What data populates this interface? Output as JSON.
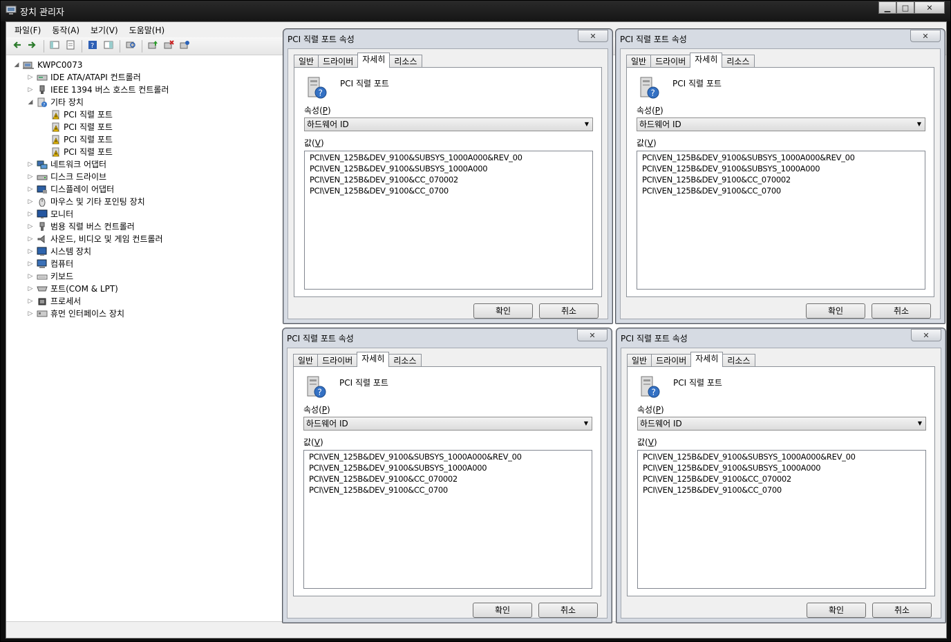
{
  "window": {
    "title": "장치 관리자",
    "min_label": "▁",
    "max_label": "□",
    "close_label": "✕"
  },
  "menu": [
    {
      "label": "파일(F)"
    },
    {
      "label": "동작(A)"
    },
    {
      "label": "보기(V)"
    },
    {
      "label": "도움말(H)"
    }
  ],
  "toolbar": {
    "icons": [
      "back-arrow-icon",
      "forward-arrow-icon",
      "show-hide-tree-icon",
      "properties-icon",
      "help-icon",
      "show-hide-action-pane-icon",
      "scan-hardware-icon",
      "update-driver-icon",
      "disable-device-icon",
      "uninstall-device-icon"
    ]
  },
  "tree": {
    "root": "KWPC0073",
    "items": [
      {
        "label": "IDE ATA/ATAPI 컨트롤러",
        "level": 1,
        "icon": "ide-controller-icon"
      },
      {
        "label": "IEEE 1394 버스 호스트 컨트롤러",
        "level": 1,
        "icon": "ieee1394-icon"
      },
      {
        "label": "기타 장치",
        "level": 1,
        "icon": "unknown-device-icon",
        "expanded": true
      },
      {
        "label": "PCI 직렬 포트",
        "level": 2,
        "icon": "warning-device-icon"
      },
      {
        "label": "PCI 직렬 포트",
        "level": 2,
        "icon": "warning-device-icon"
      },
      {
        "label": "PCI 직렬 포트",
        "level": 2,
        "icon": "warning-device-icon"
      },
      {
        "label": "PCI 직렬 포트",
        "level": 2,
        "icon": "warning-device-icon"
      },
      {
        "label": "네트워크 어댑터",
        "level": 1,
        "icon": "network-adapter-icon"
      },
      {
        "label": "디스크 드라이브",
        "level": 1,
        "icon": "disk-drive-icon"
      },
      {
        "label": "디스플레이 어댑터",
        "level": 1,
        "icon": "display-adapter-icon"
      },
      {
        "label": "마우스 및 기타 포인팅 장치",
        "level": 1,
        "icon": "mouse-icon"
      },
      {
        "label": "모니터",
        "level": 1,
        "icon": "monitor-icon"
      },
      {
        "label": "범용 직렬 버스 컨트롤러",
        "level": 1,
        "icon": "usb-icon"
      },
      {
        "label": "사운드, 비디오 및 게임 컨트롤러",
        "level": 1,
        "icon": "sound-icon"
      },
      {
        "label": "시스템 장치",
        "level": 1,
        "icon": "system-device-icon"
      },
      {
        "label": "컴퓨터",
        "level": 1,
        "icon": "computer-icon"
      },
      {
        "label": "키보드",
        "level": 1,
        "icon": "keyboard-icon"
      },
      {
        "label": "포트(COM & LPT)",
        "level": 1,
        "icon": "port-icon"
      },
      {
        "label": "프로세서",
        "level": 1,
        "icon": "processor-icon"
      },
      {
        "label": "휴먼 인터페이스 장치",
        "level": 1,
        "icon": "hid-icon"
      }
    ]
  },
  "dialogs": [
    {
      "title": "PCI 직렬 포트 속성",
      "tabs": [
        "일반",
        "드라이버",
        "자세히",
        "리소스"
      ],
      "active_tab": 2,
      "device_name": "PCI 직렬 포트",
      "property_label": "속성(",
      "property_label_key": "P",
      "property_label_end": ")",
      "property_value": "하드웨어 ID",
      "value_label": "값(",
      "value_label_key": "V",
      "value_label_end": ")",
      "values": [
        "PCI\\VEN_125B&DEV_9100&SUBSYS_1000A000&REV_00",
        "PCI\\VEN_125B&DEV_9100&SUBSYS_1000A000",
        "PCI\\VEN_125B&DEV_9100&CC_070002",
        "PCI\\VEN_125B&DEV_9100&CC_0700"
      ],
      "ok_label": "확인",
      "cancel_label": "취소"
    },
    {
      "title": "PCI 직렬 포트 속성",
      "tabs": [
        "일반",
        "드라이버",
        "자세히",
        "리소스"
      ],
      "active_tab": 2,
      "device_name": "PCI 직렬 포트",
      "property_label": "속성(",
      "property_label_key": "P",
      "property_label_end": ")",
      "property_value": "하드웨어 ID",
      "value_label": "값(",
      "value_label_key": "V",
      "value_label_end": ")",
      "values": [
        "PCI\\VEN_125B&DEV_9100&SUBSYS_1000A000&REV_00",
        "PCI\\VEN_125B&DEV_9100&SUBSYS_1000A000",
        "PCI\\VEN_125B&DEV_9100&CC_070002",
        "PCI\\VEN_125B&DEV_9100&CC_0700"
      ],
      "ok_label": "확인",
      "cancel_label": "취소"
    },
    {
      "title": "PCI 직렬 포트 속성",
      "tabs": [
        "일반",
        "드라이버",
        "자세히",
        "리소스"
      ],
      "active_tab": 2,
      "device_name": "PCI 직렬 포트",
      "property_label": "속성(",
      "property_label_key": "P",
      "property_label_end": ")",
      "property_value": "하드웨어 ID",
      "value_label": "값(",
      "value_label_key": "V",
      "value_label_end": ")",
      "values": [
        "PCI\\VEN_125B&DEV_9100&SUBSYS_1000A000&REV_00",
        "PCI\\VEN_125B&DEV_9100&SUBSYS_1000A000",
        "PCI\\VEN_125B&DEV_9100&CC_070002",
        "PCI\\VEN_125B&DEV_9100&CC_0700"
      ],
      "ok_label": "확인",
      "cancel_label": "취소"
    },
    {
      "title": "PCI 직렬 포트 속성",
      "tabs": [
        "일반",
        "드라이버",
        "자세히",
        "리소스"
      ],
      "active_tab": 2,
      "device_name": "PCI 직렬 포트",
      "property_label": "속성(",
      "property_label_key": "P",
      "property_label_end": ")",
      "property_value": "하드웨어 ID",
      "value_label": "값(",
      "value_label_key": "V",
      "value_label_end": ")",
      "values": [
        "PCI\\VEN_125B&DEV_9100&SUBSYS_1000A000&REV_00",
        "PCI\\VEN_125B&DEV_9100&SUBSYS_1000A000",
        "PCI\\VEN_125B&DEV_9100&CC_070002",
        "PCI\\VEN_125B&DEV_9100&CC_0700"
      ],
      "ok_label": "확인",
      "cancel_label": "취소"
    }
  ]
}
